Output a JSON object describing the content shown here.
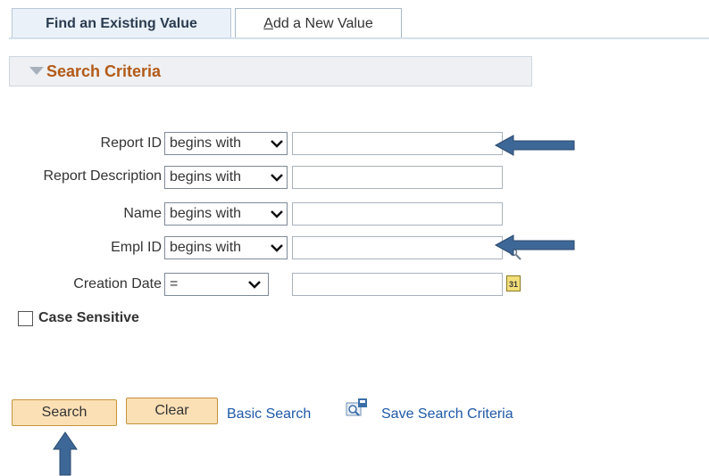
{
  "tabs": {
    "active": "Find an Existing Value",
    "inactive_prefix": "A",
    "inactive_rest": "dd a New Value"
  },
  "section": {
    "title": "Search Criteria"
  },
  "fields": [
    {
      "label": "Report ID",
      "operator": "begins with",
      "value": ""
    },
    {
      "label": "Report Description",
      "operator": "begins with",
      "value": ""
    },
    {
      "label": "Name",
      "operator": "begins with",
      "value": ""
    },
    {
      "label": "Empl ID",
      "operator": "begins with",
      "value": ""
    },
    {
      "label": "Creation Date",
      "operator": "=",
      "value": ""
    }
  ],
  "calendar": {
    "text": "31"
  },
  "case_sensitive": {
    "label": "Case Sensitive",
    "checked": false
  },
  "buttons": {
    "search": "Search",
    "clear": "Clear"
  },
  "links": {
    "basic_search": "Basic Search",
    "save_search": "Save Search Criteria"
  },
  "icons": {
    "dropdown": "chevron-down-icon",
    "calendar": "calendar-icon",
    "lookup": "magnifier-icon",
    "save_search": "save-search-icon",
    "annotation": "arrow-icon"
  },
  "colors": {
    "section_title": "#b35a17",
    "button_fill": "#fbe0b6",
    "link": "#1e59a8",
    "arrow": "#3d6796"
  }
}
